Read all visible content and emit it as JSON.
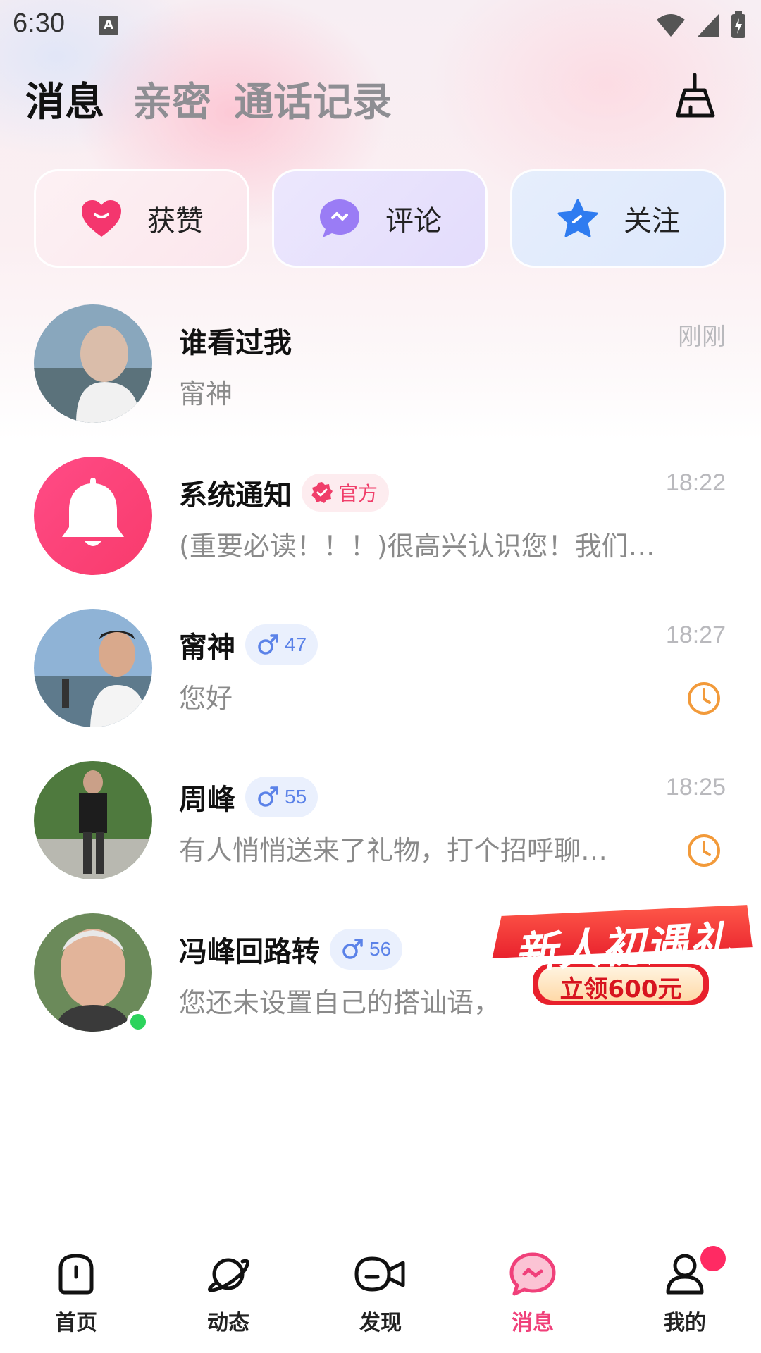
{
  "status_bar": {
    "time": "6:30"
  },
  "header": {
    "tabs": [
      {
        "label": "消息",
        "active": true
      },
      {
        "label": "亲密",
        "active": false
      },
      {
        "label": "通话记录",
        "active": false
      }
    ],
    "clean_icon": "broom-icon"
  },
  "quick_actions": [
    {
      "label": "获赞",
      "icon": "heart-icon",
      "color": "#f4366e"
    },
    {
      "label": "评论",
      "icon": "chat-bubble-icon",
      "color": "#9a7cf5"
    },
    {
      "label": "关注",
      "icon": "star-icon",
      "color": "#2f7cf0"
    }
  ],
  "conversations": [
    {
      "name": "谁看过我",
      "message": "甯神",
      "time": "刚刚"
    },
    {
      "name": "系统通知",
      "badge": "官方",
      "message": "(重要必读！！！)很高兴认识您！我们…",
      "time": "18:22"
    },
    {
      "name": "甯神",
      "age": "47",
      "message": "您好",
      "time": "18:27"
    },
    {
      "name": "周峰",
      "age": "55",
      "message": "有人悄悄送来了礼物，打个招呼聊…",
      "time": "18:25"
    },
    {
      "name": "冯峰回路转",
      "age": "56",
      "message": "您还未设置自己的搭讪语，",
      "online": true
    }
  ],
  "promo": {
    "title": "新人初遇礼",
    "subtitle": "立领600元"
  },
  "bottom_nav": [
    {
      "label": "首页",
      "icon": "home-icon"
    },
    {
      "label": "动态",
      "icon": "planet-icon"
    },
    {
      "label": "发现",
      "icon": "video-camera-icon"
    },
    {
      "label": "消息",
      "icon": "message-icon",
      "active": true
    },
    {
      "label": "我的",
      "icon": "profile-icon"
    }
  ],
  "colors": {
    "accent": "#f0407a",
    "male_badge": "#5b82e8",
    "online": "#2cd35c",
    "clock": "#f29a3a"
  }
}
